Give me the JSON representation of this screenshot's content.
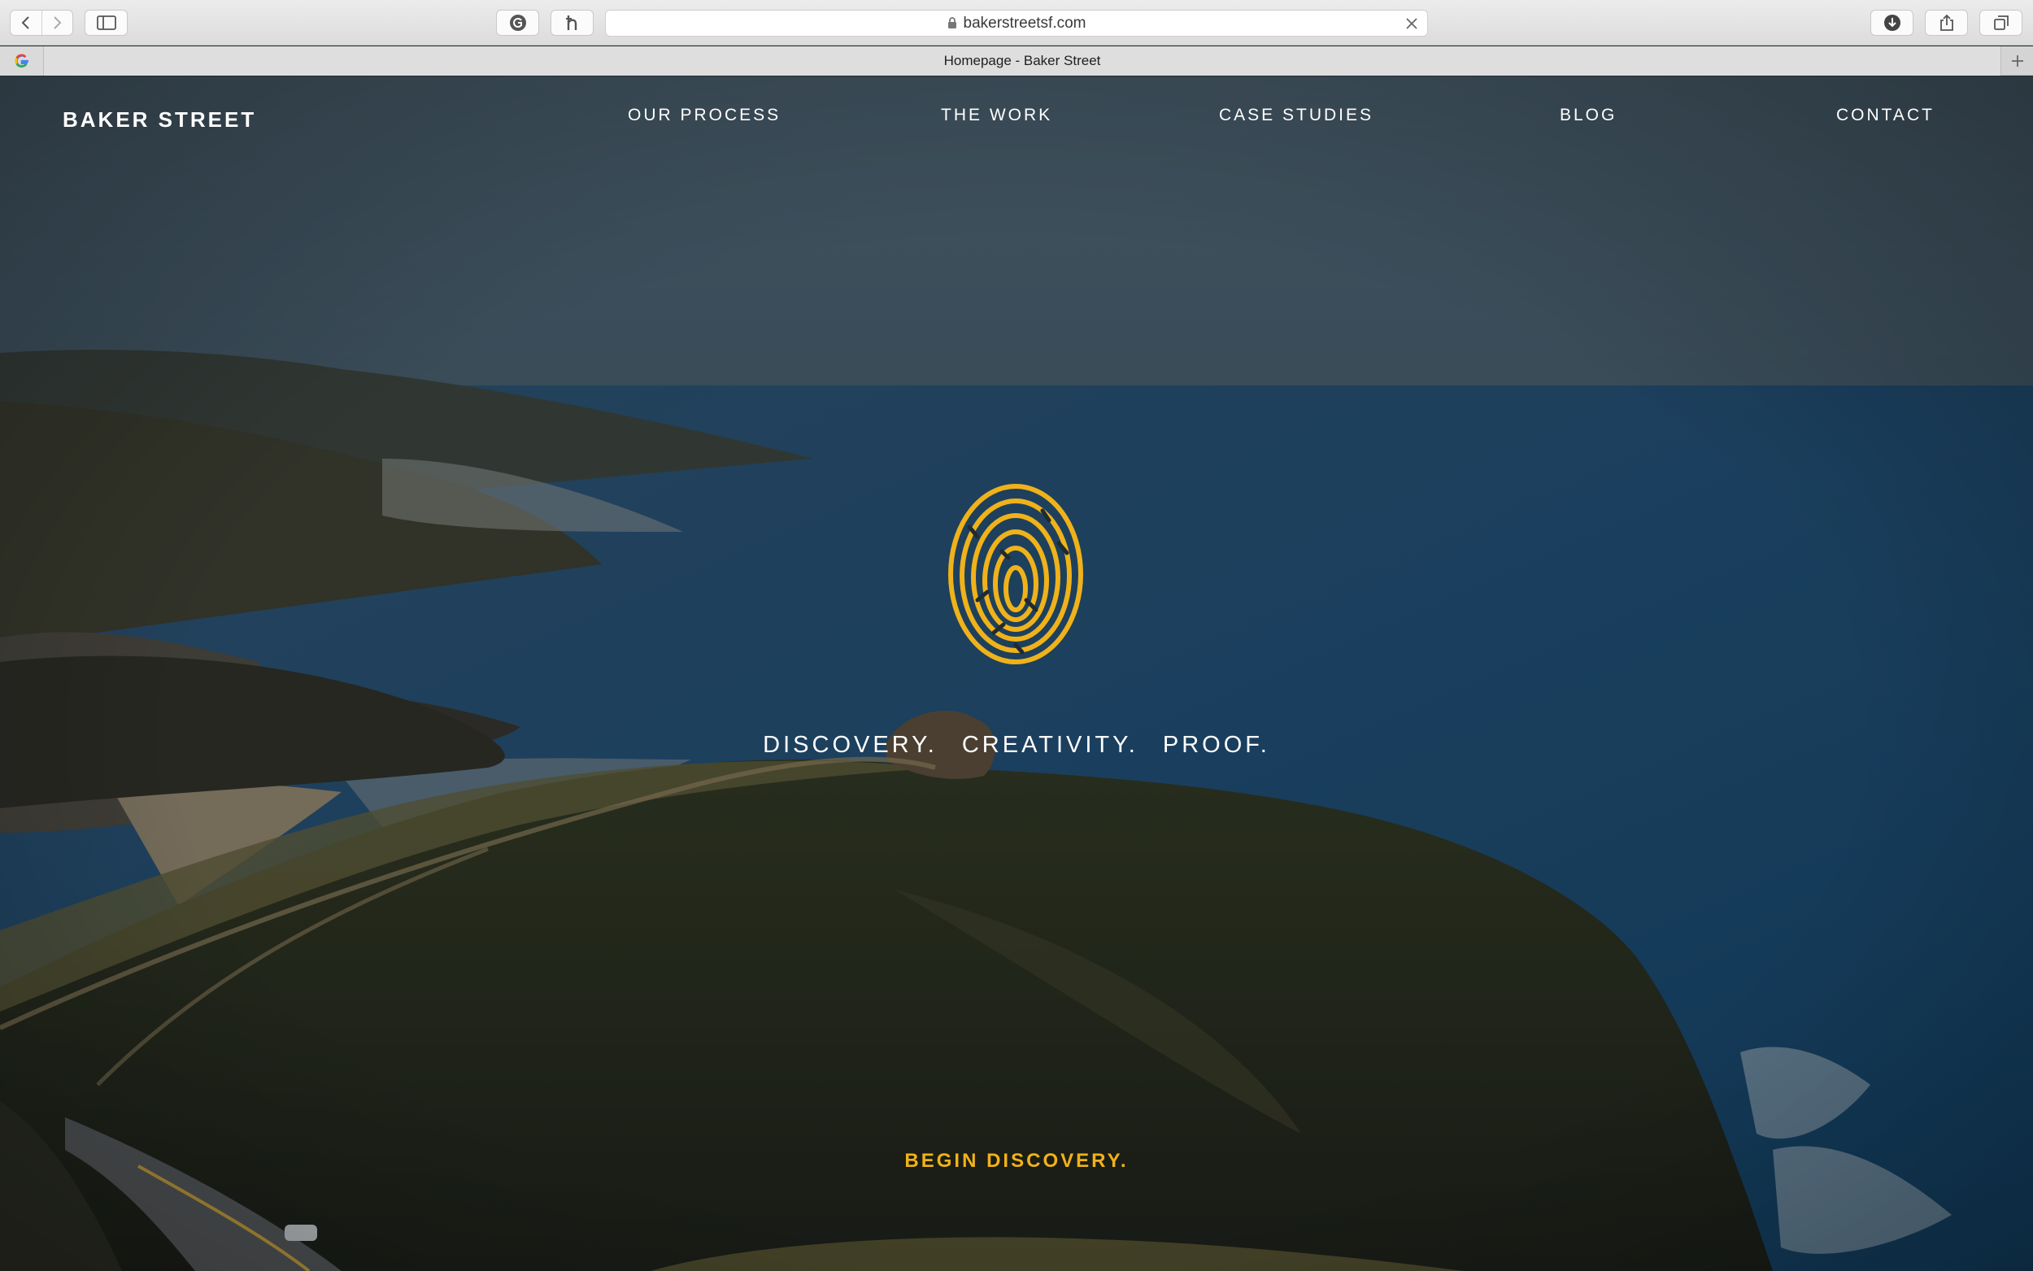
{
  "browser": {
    "url": "bakerstreetsf.com",
    "tab_title": "Homepage - Baker Street",
    "icons": [
      "back-icon",
      "forward-icon",
      "sidebar-icon",
      "grammarly-icon",
      "honey-icon",
      "lock-icon",
      "close-icon",
      "download-icon",
      "share-icon",
      "tabs-icon",
      "google-favicon",
      "plus-icon"
    ]
  },
  "site": {
    "logo": "BAKER STREET",
    "nav": [
      "OUR PROCESS",
      "THE WORK",
      "CASE STUDIES",
      "BLOG",
      "CONTACT"
    ],
    "tagline": "DISCOVERY. CREATIVITY. PROOF.",
    "cta": "BEGIN DISCOVERY."
  },
  "colors": {
    "accent": "#f0b21a",
    "text": "#ffffff"
  }
}
